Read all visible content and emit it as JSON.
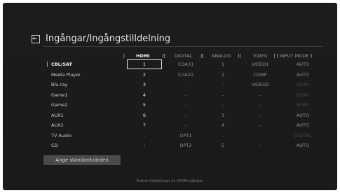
{
  "title": "Ingångar/Ingångstilldelning",
  "headers": [
    {
      "key": "hdmi",
      "label": "HDMI"
    },
    {
      "key": "digital",
      "label": "DIGITAL"
    },
    {
      "key": "analog",
      "label": "ANALOG"
    },
    {
      "key": "video",
      "label": "VIDEO"
    },
    {
      "key": "mode",
      "label": "INPUT MODE"
    }
  ],
  "bracket_open": "[",
  "bracket_mid": "][",
  "bracket_close": "]",
  "rows": [
    {
      "name": "CBL/SAT",
      "hdmi": "1",
      "digital": "COAX1",
      "analog": "1",
      "video": "VIDEO1",
      "mode": "AUTO",
      "mode_dim": false,
      "selected": true
    },
    {
      "name": "Media Player",
      "hdmi": "2",
      "digital": "COAX2",
      "analog": "2",
      "video": "COMP",
      "mode": "AUTO",
      "mode_dim": false,
      "selected": false
    },
    {
      "name": "Blu-ray",
      "hdmi": "3",
      "digital": "-",
      "analog": "-",
      "video": "VIDEO2",
      "mode": "HDMI",
      "mode_dim": true,
      "selected": false
    },
    {
      "name": "Game1",
      "hdmi": "4",
      "digital": "-",
      "analog": "-",
      "video": "-",
      "mode": "HDMI",
      "mode_dim": true,
      "selected": false
    },
    {
      "name": "Game2",
      "hdmi": "5",
      "digital": "-",
      "analog": "-",
      "video": "-",
      "mode": "HDMI",
      "mode_dim": true,
      "selected": false
    },
    {
      "name": "AUX1",
      "hdmi": "6",
      "digital": "-",
      "analog": "3",
      "video": "-",
      "mode": "AUTO",
      "mode_dim": false,
      "selected": false
    },
    {
      "name": "AUX2",
      "hdmi": "7",
      "digital": "-",
      "analog": "4",
      "video": "-",
      "mode": "AUTO",
      "mode_dim": false,
      "selected": false
    },
    {
      "name": "TV Audio",
      "hdmi": "-",
      "digital": "OPT1",
      "analog": "-",
      "video": "-",
      "mode": "DIGITAL",
      "mode_dim": true,
      "selected": false
    },
    {
      "name": "CD",
      "hdmi": "-",
      "digital": "OPT2",
      "analog": "5",
      "video": "-",
      "mode": "AUTO",
      "mode_dim": false,
      "selected": false
    }
  ],
  "button": "Ange standardvärden",
  "hint": "Ändrar tilldelningar av HDMI-ingångar."
}
